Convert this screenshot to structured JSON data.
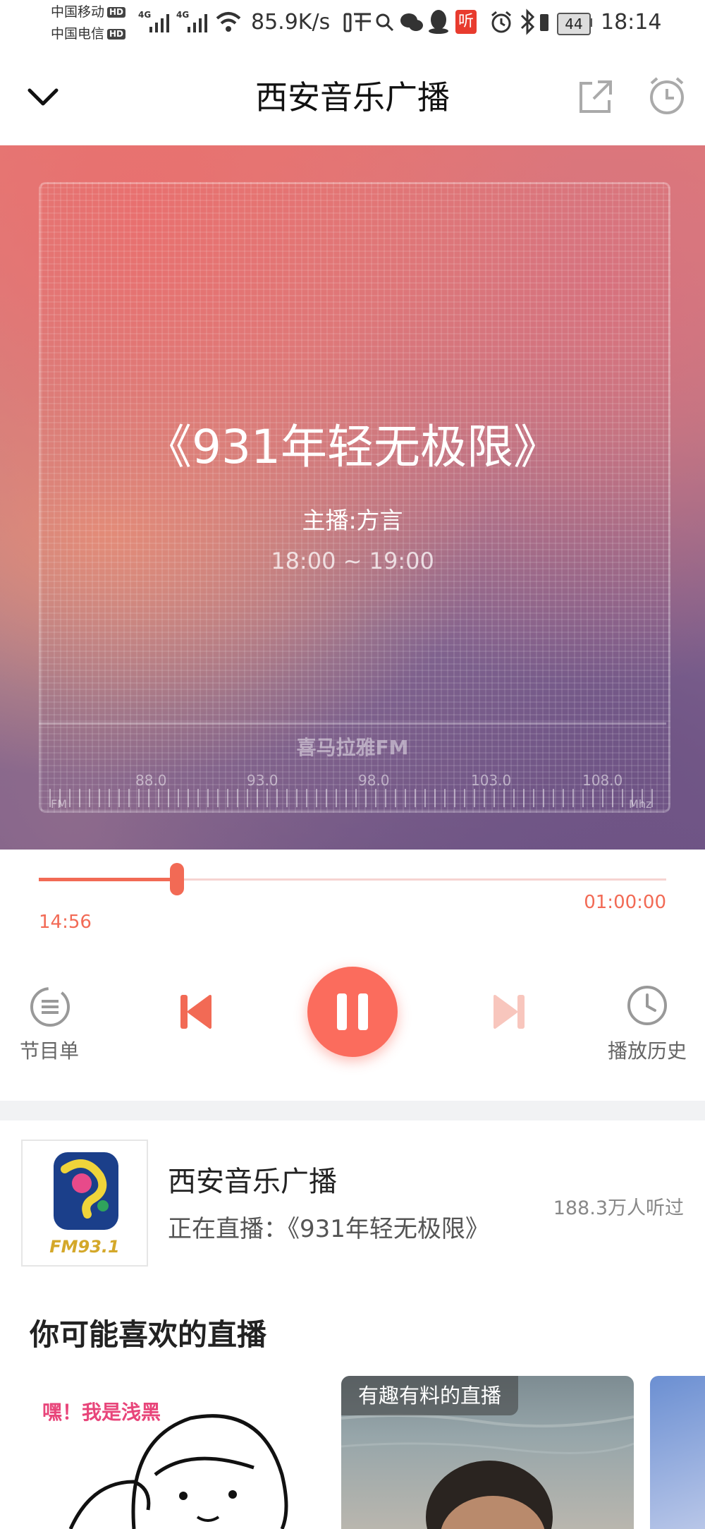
{
  "status_bar": {
    "carrier1": "中国移动",
    "carrier2": "中国电信",
    "hd_badge": "HD",
    "net_label1": "4G",
    "net_label2": "4G",
    "net_speed": "85.9K/s",
    "listen_app_badge": "听",
    "battery": "44",
    "clock": "18:14"
  },
  "header": {
    "title": "西安音乐广播"
  },
  "player": {
    "program_title": "《931年轻无极限》",
    "host": "主播:方言",
    "schedule": "18:00 ~ 19:00",
    "dial_brand": "喜马拉雅FM",
    "dial_freqs": [
      "88.0",
      "93.0",
      "98.0",
      "103.0",
      "108.0"
    ],
    "dial_fm": "FM",
    "dial_unit": "Mhz",
    "progress_fraction": 0.25,
    "elapsed": "14:56",
    "total": "01:00:00"
  },
  "controls": {
    "playlist_label": "节目单",
    "history_label": "播放历史"
  },
  "station": {
    "name": "西安音乐广播",
    "now_playing": "正在直播：《931年轻无极限》",
    "listens": "188.3万人听过",
    "logo_text": "FM93.1"
  },
  "recommend": {
    "title": "你可能喜欢的直播",
    "card1_text": "嘿！我是浅黑",
    "card2_tag": "有趣有料的直播"
  },
  "colors": {
    "accent": "#f26a55",
    "play_button": "#fb6c5d"
  }
}
